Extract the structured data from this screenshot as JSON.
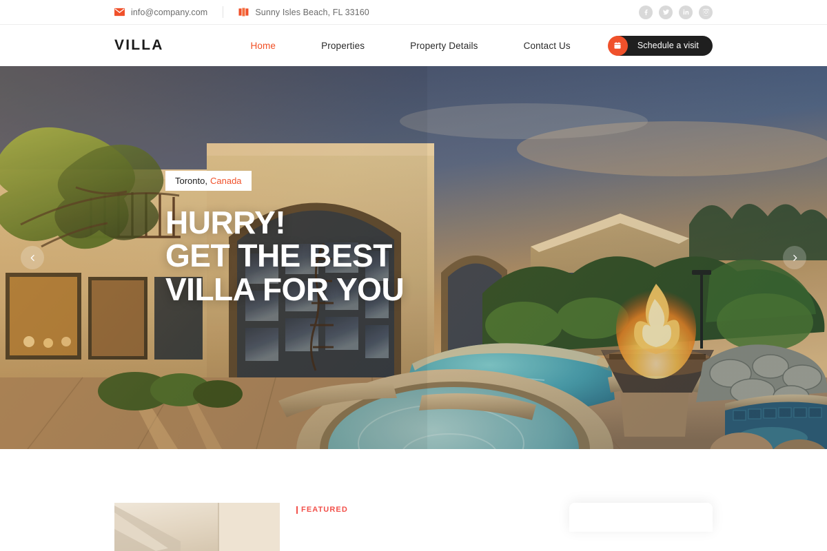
{
  "topbar": {
    "email": "info@company.com",
    "email_icon": "envelope-icon",
    "address": "Sunny Isles Beach, FL 33160",
    "address_icon": "map-icon",
    "socials": [
      {
        "name": "facebook",
        "label": "Facebook"
      },
      {
        "name": "twitter",
        "label": "Twitter"
      },
      {
        "name": "linkedin",
        "label": "LinkedIn"
      },
      {
        "name": "instagram",
        "label": "Instagram"
      }
    ]
  },
  "nav": {
    "logo": "VILLA",
    "links": [
      {
        "label": "Home",
        "active": true
      },
      {
        "label": "Properties",
        "active": false
      },
      {
        "label": "Property Details",
        "active": false
      },
      {
        "label": "Contact Us",
        "active": false
      }
    ],
    "cta": {
      "label": "Schedule a visit",
      "icon": "calendar-icon"
    }
  },
  "hero": {
    "location_city": "Toronto,",
    "location_country": "Canada",
    "title_lines": [
      "HURRY!",
      "GET THE BEST",
      "VILLA FOR YOU"
    ],
    "prev_icon": "chevron-left-icon",
    "next_icon": "chevron-right-icon"
  },
  "featured": {
    "tag": "FEATURED"
  },
  "colors": {
    "accent_orange": "#f0512b",
    "featured_red": "#f2504a",
    "dark": "#1f1f1f",
    "muted_text": "#6b6b6b",
    "social_gray": "#d9d9d9"
  }
}
